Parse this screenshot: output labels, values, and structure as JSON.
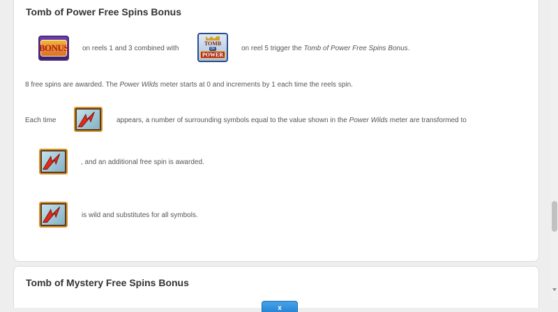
{
  "section1": {
    "title": "Tomb of Power Free Spins Bonus",
    "row1": {
      "text_a": "on reels 1 and 3 combined with",
      "text_b": "on reel 5 trigger the ",
      "text_b_em": "Tomb of Power Free Spins Bonus",
      "text_b_end": "."
    },
    "row2": {
      "text_a": "8 free spins are awarded. The ",
      "text_em": "Power Wilds",
      "text_b": " meter starts at 0 and increments by 1 each time the reels spin."
    },
    "row3": {
      "lead": "Each time",
      "text_a": "appears, a number of surrounding symbols equal to the value shown in the ",
      "text_em": "Power Wilds",
      "text_b": " meter are transformed to"
    },
    "row4": {
      "text": ", and an additional free spin is awarded."
    },
    "row5": {
      "text": "is wild and substitutes for all symbols."
    },
    "symbols": {
      "bonus_label": "BONUS",
      "tomb_top": "TOMB",
      "tomb_of": "OF",
      "tomb_power": "POWER"
    }
  },
  "section2": {
    "title": "Tomb of Mystery Free Spins Bonus"
  },
  "close_button": {
    "label": "x"
  },
  "icons": {
    "bonus": "bonus-symbol-icon",
    "tomb": "tomb-of-power-symbol-icon",
    "wild": "power-wild-symbol-icon"
  },
  "colors": {
    "button": "#1f7fd0",
    "background": "#eeeeee",
    "card": "#ffffff"
  }
}
